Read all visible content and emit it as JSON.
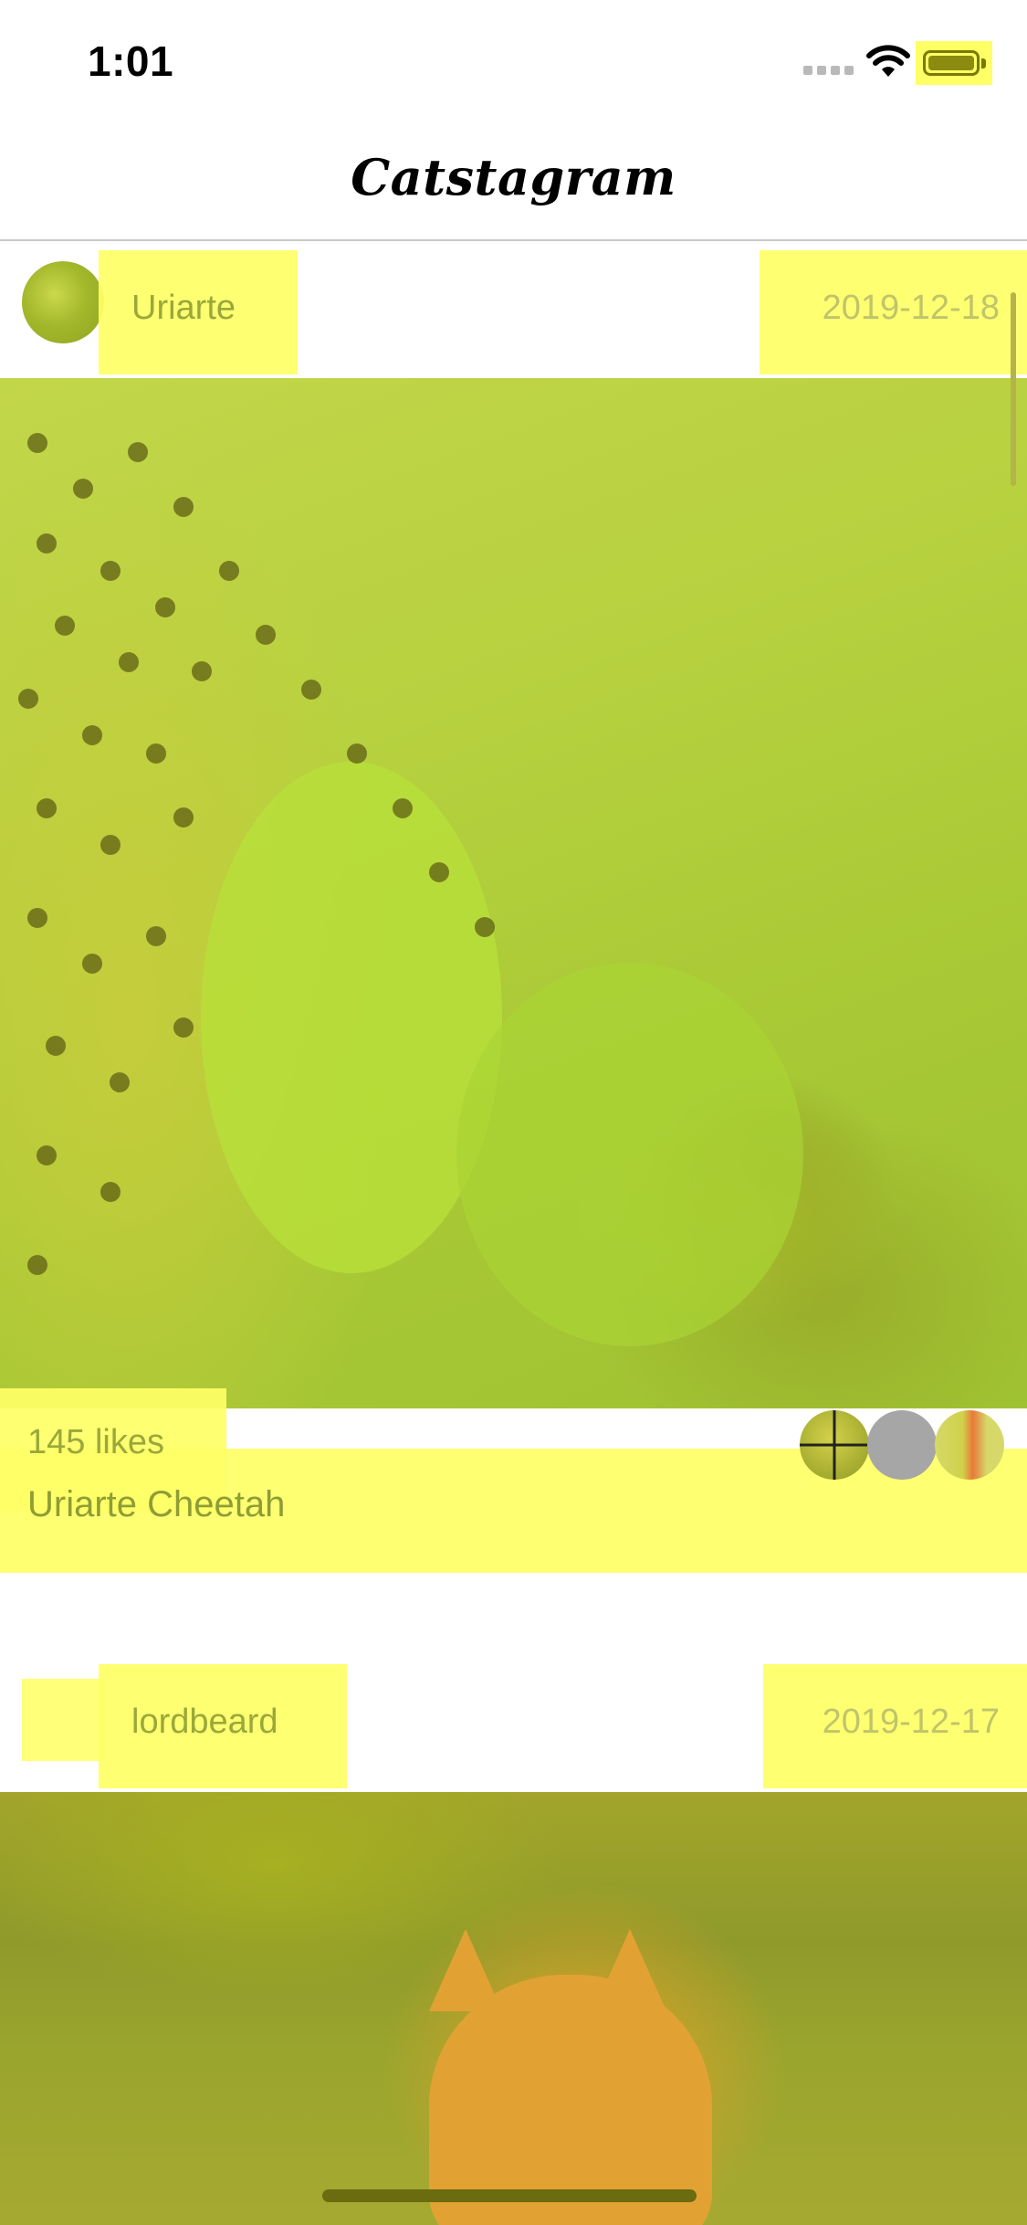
{
  "status_bar": {
    "time": "1:01",
    "icons": [
      "cellular-signal-icon",
      "wifi-icon",
      "battery-icon"
    ]
  },
  "nav": {
    "title": "Catstagram"
  },
  "posts": [
    {
      "username": "Uriarte",
      "date": "2019-12-18",
      "likes": "145 likes",
      "caption": "Uriarte Cheetah",
      "image": "cheetah-photo"
    },
    {
      "username": "lordbeard",
      "date": "2019-12-17",
      "image": "cat-photo"
    }
  ],
  "colors": {
    "highlight": "#ffff66",
    "text_muted": "#9aa83a",
    "divider": "#c8c8c8"
  }
}
